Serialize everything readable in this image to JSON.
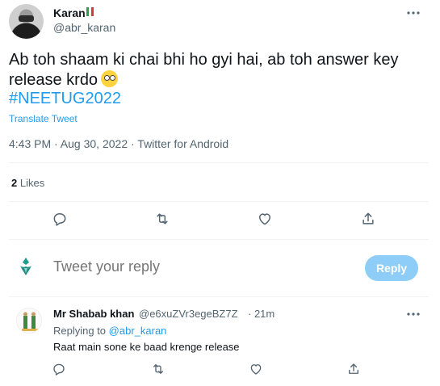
{
  "tweet": {
    "author_name": "Karan",
    "author_handle": "@abr_karan",
    "text": "Ab toh shaam ki chai bhi ho gyi hai, ab toh answer key release krdo",
    "hashtag": "#NEETUG2022",
    "translate_label": "Translate Tweet",
    "timestamp": "4:43 PM · Aug 30, 2022 · Twitter for Android",
    "likes_count": "2",
    "likes_label": "Likes",
    "icons": {
      "reply": "reply-icon",
      "retweet": "retweet-icon",
      "like": "heart-icon",
      "share": "share-icon",
      "more": "more-icon"
    }
  },
  "composer": {
    "placeholder": "Tweet your reply",
    "button_label": "Reply"
  },
  "reply": {
    "author_name": "Mr Shabab khan",
    "author_handle": "@e6xuZVr3egeBZ7Z",
    "time": "· 21m",
    "replying_prefix": "Replying to",
    "replying_to": "@abr_karan",
    "text": "Raat main sone ke baad krenge release"
  },
  "colors": {
    "accent": "#1d9bf0",
    "secondary_text": "#536471",
    "reply_button_disabled": "#8ecdf8"
  }
}
